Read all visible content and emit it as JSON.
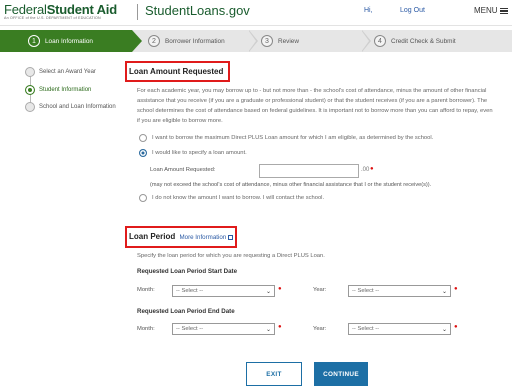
{
  "header": {
    "brand_left_word1": "Federal",
    "brand_left_word2": "Student Aid",
    "brand_tagline": "An OFFICE of the U.S. DEPARTMENT of EDUCATION",
    "brand_right_a": "StudentLoans",
    "brand_right_b": ".gov",
    "hi_link": "Hi,",
    "logout_link": "Log Out",
    "menu_label": "MENU"
  },
  "steps": [
    {
      "num": "1",
      "label": "Loan Information",
      "active": true
    },
    {
      "num": "2",
      "label": "Borrower Information",
      "active": false
    },
    {
      "num": "3",
      "label": "Review",
      "active": false
    },
    {
      "num": "4",
      "label": "Credit Check & Submit",
      "active": false
    }
  ],
  "sidebar": {
    "items": [
      {
        "label": "Select an Award Year",
        "current": false
      },
      {
        "label": "Student Information",
        "current": true
      },
      {
        "label": "School and Loan Information",
        "current": false
      }
    ]
  },
  "loan_amount": {
    "title": "Loan Amount Requested",
    "description": "For each academic year, you may borrow up to - but not more than - the school's cost of attendance, minus the amount of other financial assistance that you receive (if you are a graduate or professional student) or that the student receives (if you are a parent borrower). The school determines the cost of attendance based on federal guidelines. It is important not to borrow more than you can afford to repay, even if you are eligible to borrow more.",
    "option_max": "I want to borrow the maximum Direct PLUS Loan amount for which I am eligible, as determined by the school.",
    "option_specify": "I would like to specify a loan amount.",
    "amount_label": "Loan Amount Requested:",
    "amount_value": "",
    "amount_suffix": ".00",
    "amount_note": "(may not exceed the school's cost of attendance, minus other financial assistance that I or the student receive(s)).",
    "option_unknown": "I do not know the amount I want to borrow. I will contact the school.",
    "selected": "specify"
  },
  "loan_period": {
    "title": "Loan Period",
    "more_info": "More Information",
    "description": "Specify the loan period for which you are requesting a Direct PLUS Loan.",
    "start_heading": "Requested Loan Period Start Date",
    "end_heading": "Requested Loan Period End Date",
    "month_label": "Month:",
    "year_label": "Year:",
    "select_placeholder": "-- Select --"
  },
  "buttons": {
    "exit": "EXIT",
    "continue": "CONTINUE"
  },
  "colors": {
    "brand_green": "#1a5c2e",
    "step_active": "#3a7d22",
    "highlight_box": "#e01b1b",
    "primary_blue": "#1d6fa5",
    "required_marker": "#dd1111"
  }
}
